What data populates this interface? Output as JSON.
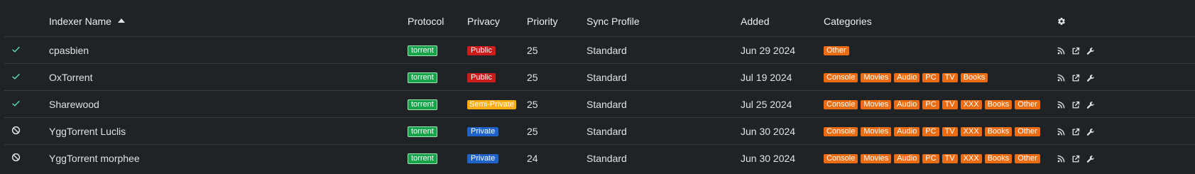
{
  "columns": {
    "name": "Indexer Name",
    "protocol": "Protocol",
    "privacy": "Privacy",
    "priority": "Priority",
    "sync_profile": "Sync Profile",
    "added": "Added",
    "categories": "Categories",
    "settings_icon": "gear-icon"
  },
  "sort": {
    "column": "Indexer Name",
    "direction": "ascending"
  },
  "colors": {
    "torrent": "#16a34a",
    "public": "#cc1b1b",
    "semi_private": "#ffad12",
    "private": "#1f63c8",
    "category": "#ec6c12",
    "enabled_check": "#5ad8b4"
  },
  "rows": [
    {
      "status": "enabled",
      "status_icon": "check-icon",
      "name": "cpasbien",
      "protocol": "torrent",
      "privacy": "Public",
      "priority": "25",
      "sync_profile": "Standard",
      "added": "Jun 29 2024",
      "categories": [
        "Other"
      ]
    },
    {
      "status": "enabled",
      "status_icon": "check-icon",
      "name": "OxTorrent",
      "protocol": "torrent",
      "privacy": "Public",
      "priority": "25",
      "sync_profile": "Standard",
      "added": "Jul 19 2024",
      "categories": [
        "Console",
        "Movies",
        "Audio",
        "PC",
        "TV",
        "Books"
      ]
    },
    {
      "status": "enabled",
      "status_icon": "check-icon",
      "name": "Sharewood",
      "protocol": "torrent",
      "privacy": "Semi-Private",
      "priority": "25",
      "sync_profile": "Standard",
      "added": "Jul 25 2024",
      "categories": [
        "Console",
        "Movies",
        "Audio",
        "PC",
        "TV",
        "XXX",
        "Books",
        "Other"
      ]
    },
    {
      "status": "disabled",
      "status_icon": "ban-icon",
      "name": "YggTorrent Luclis",
      "protocol": "torrent",
      "privacy": "Private",
      "priority": "25",
      "sync_profile": "Standard",
      "added": "Jun 30 2024",
      "categories": [
        "Console",
        "Movies",
        "Audio",
        "PC",
        "TV",
        "XXX",
        "Books",
        "Other"
      ]
    },
    {
      "status": "disabled",
      "status_icon": "ban-icon",
      "name": "YggTorrent morphee",
      "protocol": "torrent",
      "privacy": "Private",
      "priority": "24",
      "sync_profile": "Standard",
      "added": "Jun 30 2024",
      "categories": [
        "Console",
        "Movies",
        "Audio",
        "PC",
        "TV",
        "XXX",
        "Books",
        "Other"
      ]
    }
  ],
  "row_actions": [
    "rss-icon",
    "external-link-icon",
    "wrench-icon"
  ]
}
